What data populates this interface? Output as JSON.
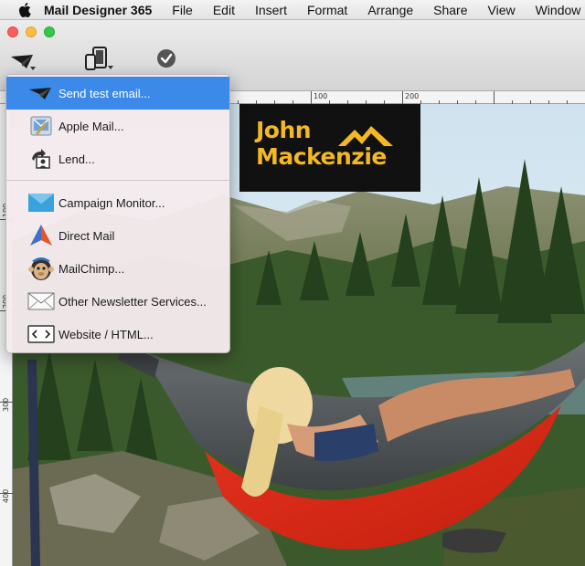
{
  "menubar": {
    "app_name": "Mail Designer 365",
    "items": [
      "File",
      "Edit",
      "Insert",
      "Format",
      "Arrange",
      "Share",
      "View",
      "Window"
    ]
  },
  "rulers": {
    "top_labels": [
      "100",
      "200"
    ],
    "left_labels": [
      "100",
      "200",
      "300",
      "400"
    ]
  },
  "logo": {
    "line1": "John",
    "line2": "Mackenzie",
    "color": "#f3b823"
  },
  "share_menu": {
    "items": [
      {
        "label": "Send test email...",
        "icon": "paper-plane-icon",
        "selected": true
      },
      {
        "label": "Apple Mail...",
        "icon": "apple-mail-icon"
      },
      {
        "label": "Lend...",
        "icon": "lend-icon"
      },
      {
        "label": "Campaign Monitor...",
        "icon": "campaign-monitor-icon"
      },
      {
        "label": "Direct Mail",
        "icon": "direct-mail-icon"
      },
      {
        "label": "MailChimp...",
        "icon": "mailchimp-icon"
      },
      {
        "label": "Other Newsletter Services...",
        "icon": "envelope-icon"
      },
      {
        "label": "Website / HTML...",
        "icon": "html-code-icon"
      }
    ]
  },
  "colors": {
    "selection": "#3b89e8",
    "close": "#fc605c",
    "minimize": "#fdbc40",
    "zoom": "#34c84a"
  }
}
